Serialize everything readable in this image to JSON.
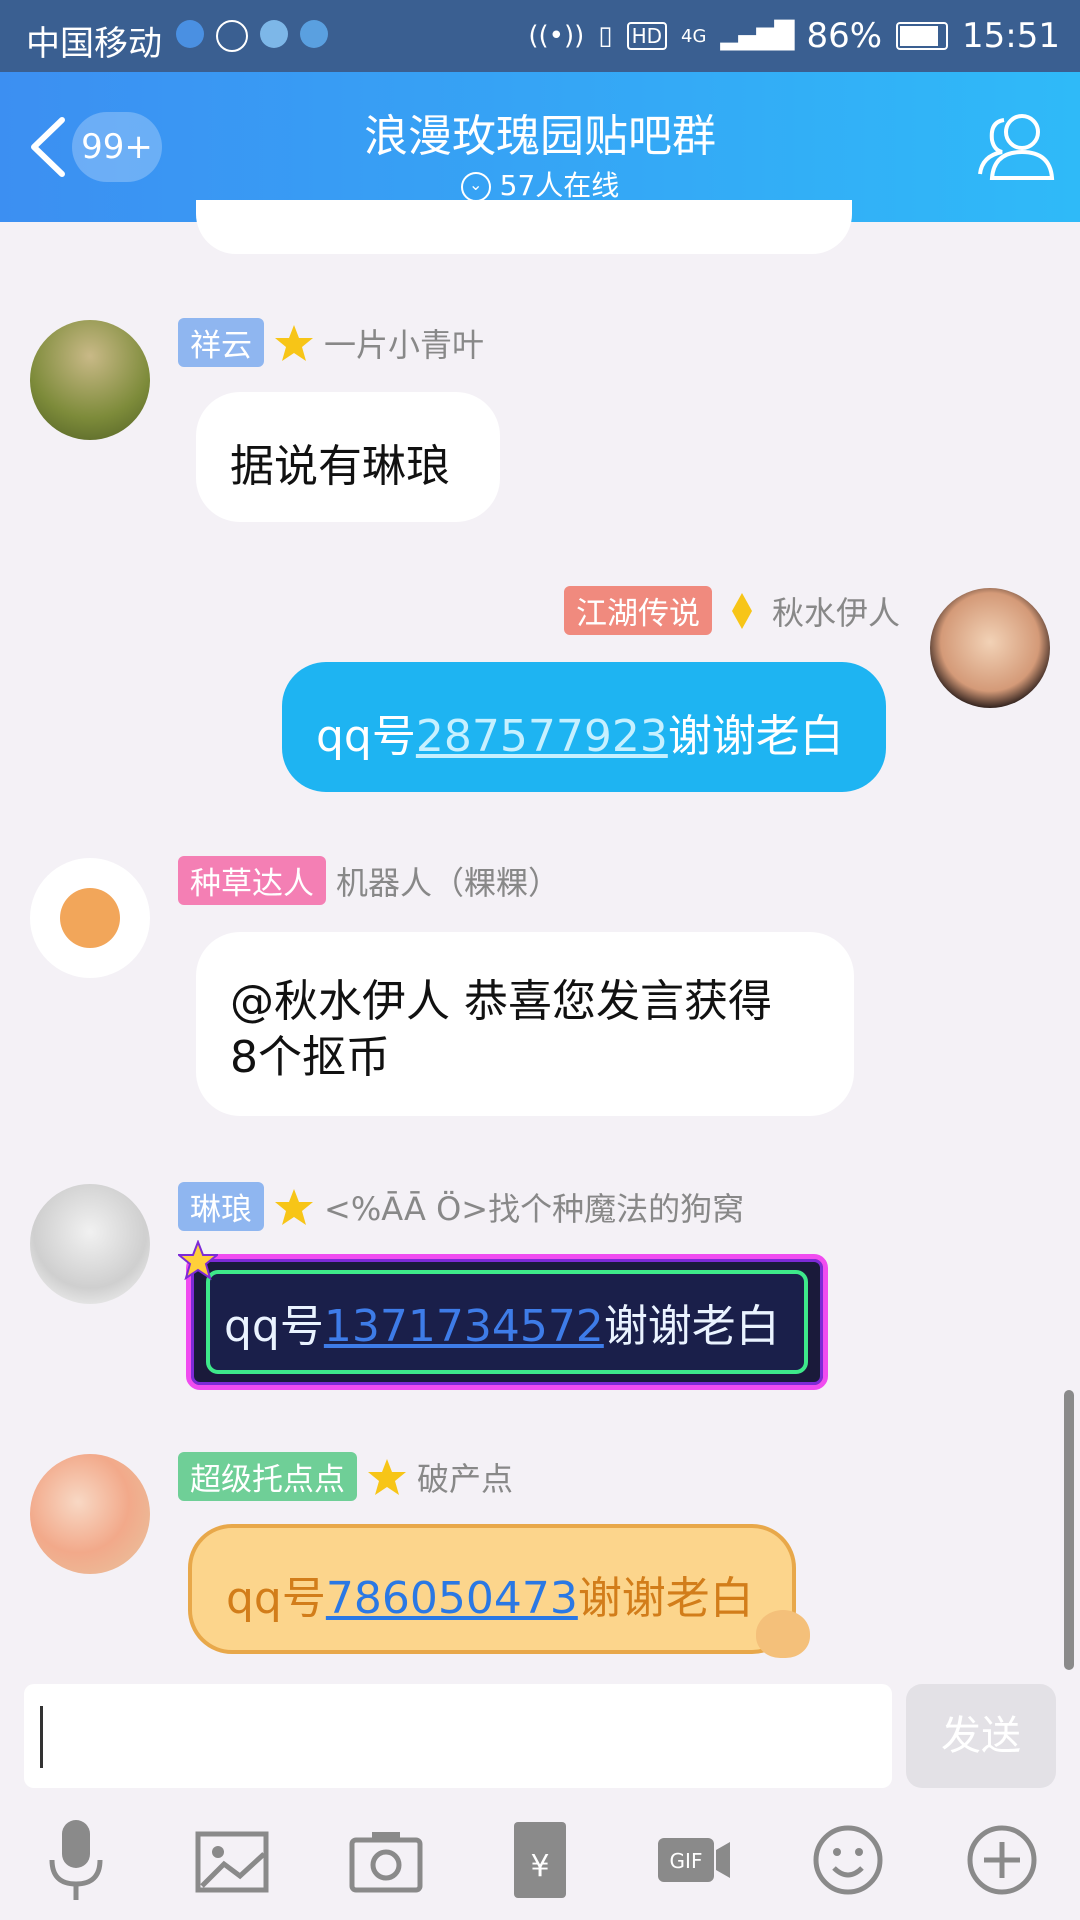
{
  "status_bar": {
    "carrier": "中国移动",
    "signal_text": "HD",
    "network": "4G",
    "battery": "86%",
    "time": "15:51"
  },
  "header": {
    "unread_count": "99+",
    "title": "浪漫玫瑰园贴吧群",
    "online": "57人在线"
  },
  "messages": [
    {
      "tag": "祥云",
      "tag_color": "#8fb6f0",
      "nickname": "一片小青叶",
      "text": "据说有琳琅"
    },
    {
      "tag": "江湖传说",
      "tag_color": "#f08a7e",
      "nickname": "秋水伊人",
      "prefix": "qq号",
      "number": "287577923",
      "suffix": "谢谢老白"
    },
    {
      "tag": "种草达人",
      "tag_color": "#f47fb4",
      "nickname": "机器人（粿粿）",
      "line1": "@秋水伊人 恭喜您发言获得",
      "line2": "8个抠币"
    },
    {
      "tag": "琳琅",
      "tag_color": "#8fb6f0",
      "nickname": "<%ĀĀ Ö>找个种魔法的狗窝",
      "prefix": "qq号",
      "number": "1371734572",
      "suffix": "谢谢老白"
    },
    {
      "tag": "超级托点点",
      "tag_color": "#6fcf97",
      "nickname": "破产点",
      "prefix": "qq号",
      "number": "786050473",
      "suffix": "谢谢老白"
    }
  ],
  "input": {
    "value": "",
    "send_label": "发送"
  },
  "toolbar": {
    "icons": [
      "microphone-icon",
      "image-icon",
      "camera-icon",
      "red-packet-icon",
      "gif-icon",
      "emoji-icon",
      "plus-icon"
    ]
  },
  "colors": {
    "header_start": "#3c8ff2",
    "header_end": "#2fbaf8",
    "own_bubble": "#1eb4f2",
    "link_blue": "#2a78e4"
  }
}
